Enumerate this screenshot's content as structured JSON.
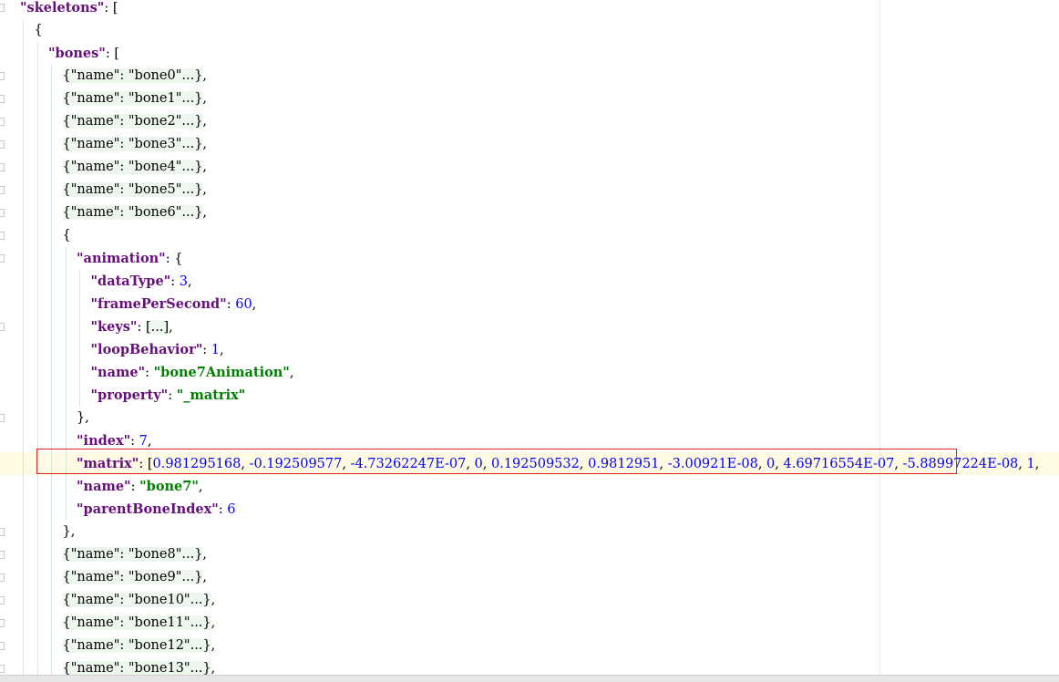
{
  "lines": [
    {
      "indent": 0,
      "parts": [
        {
          "t": "\"skeletons\"",
          "c": "k"
        },
        {
          "t": ": [",
          "c": "p"
        }
      ]
    },
    {
      "indent": 1,
      "parts": [
        {
          "t": "{",
          "c": "p"
        }
      ]
    },
    {
      "indent": 2,
      "parts": [
        {
          "t": "\"bones\"",
          "c": "k"
        },
        {
          "t": ": [",
          "c": "p"
        }
      ]
    },
    {
      "indent": 3,
      "parts": [
        {
          "t": "{\"name\": \"bone0\"...}",
          "c": "fold"
        },
        {
          "t": ",",
          "c": "p"
        }
      ]
    },
    {
      "indent": 3,
      "parts": [
        {
          "t": "{\"name\": \"bone1\"...}",
          "c": "fold"
        },
        {
          "t": ",",
          "c": "p"
        }
      ]
    },
    {
      "indent": 3,
      "parts": [
        {
          "t": "{\"name\": \"bone2\"...}",
          "c": "fold"
        },
        {
          "t": ",",
          "c": "p"
        }
      ]
    },
    {
      "indent": 3,
      "parts": [
        {
          "t": "{\"name\": \"bone3\"...}",
          "c": "fold"
        },
        {
          "t": ",",
          "c": "p"
        }
      ]
    },
    {
      "indent": 3,
      "parts": [
        {
          "t": "{\"name\": \"bone4\"...}",
          "c": "fold"
        },
        {
          "t": ",",
          "c": "p"
        }
      ]
    },
    {
      "indent": 3,
      "parts": [
        {
          "t": "{\"name\": \"bone5\"...}",
          "c": "fold"
        },
        {
          "t": ",",
          "c": "p"
        }
      ]
    },
    {
      "indent": 3,
      "parts": [
        {
          "t": "{\"name\": \"bone6\"...}",
          "c": "fold"
        },
        {
          "t": ",",
          "c": "p"
        }
      ]
    },
    {
      "indent": 3,
      "parts": [
        {
          "t": "{",
          "c": "p"
        }
      ]
    },
    {
      "indent": 4,
      "parts": [
        {
          "t": "\"animation\"",
          "c": "k"
        },
        {
          "t": ": {",
          "c": "p"
        }
      ]
    },
    {
      "indent": 5,
      "parts": [
        {
          "t": "\"dataType\"",
          "c": "k"
        },
        {
          "t": ": ",
          "c": "p"
        },
        {
          "t": "3",
          "c": "n"
        },
        {
          "t": ",",
          "c": "p"
        }
      ]
    },
    {
      "indent": 5,
      "parts": [
        {
          "t": "\"framePerSecond\"",
          "c": "k"
        },
        {
          "t": ": ",
          "c": "p"
        },
        {
          "t": "60",
          "c": "n"
        },
        {
          "t": ",",
          "c": "p"
        }
      ]
    },
    {
      "indent": 5,
      "parts": [
        {
          "t": "\"keys\"",
          "c": "k"
        },
        {
          "t": ": ",
          "c": "p"
        },
        {
          "t": "[...]",
          "c": "fold"
        },
        {
          "t": ",",
          "c": "p"
        }
      ]
    },
    {
      "indent": 5,
      "parts": [
        {
          "t": "\"loopBehavior\"",
          "c": "k"
        },
        {
          "t": ": ",
          "c": "p"
        },
        {
          "t": "1",
          "c": "n"
        },
        {
          "t": ",",
          "c": "p"
        }
      ]
    },
    {
      "indent": 5,
      "parts": [
        {
          "t": "\"name\"",
          "c": "k"
        },
        {
          "t": ": ",
          "c": "p"
        },
        {
          "t": "\"bone7Animation\"",
          "c": "s"
        },
        {
          "t": ",",
          "c": "p"
        }
      ]
    },
    {
      "indent": 5,
      "parts": [
        {
          "t": "\"property\"",
          "c": "k"
        },
        {
          "t": ": ",
          "c": "p"
        },
        {
          "t": "\"_matrix\"",
          "c": "s"
        }
      ]
    },
    {
      "indent": 4,
      "parts": [
        {
          "t": "},",
          "c": "p"
        }
      ]
    },
    {
      "indent": 4,
      "parts": [
        {
          "t": "\"index\"",
          "c": "k"
        },
        {
          "t": ": ",
          "c": "p"
        },
        {
          "t": "7",
          "c": "n"
        },
        {
          "t": ",",
          "c": "p"
        }
      ]
    },
    {
      "indent": 4,
      "parts": [
        {
          "t": "\"matrix\"",
          "c": "k"
        },
        {
          "t": ": [",
          "c": "p"
        },
        {
          "t": "0.981295168",
          "c": "n"
        },
        {
          "t": ", ",
          "c": "p"
        },
        {
          "t": "-0.192509577",
          "c": "n"
        },
        {
          "t": ", ",
          "c": "p"
        },
        {
          "t": "-4.73262247E-07",
          "c": "n"
        },
        {
          "t": ", ",
          "c": "p"
        },
        {
          "t": "0",
          "c": "n"
        },
        {
          "t": ", ",
          "c": "p"
        },
        {
          "t": "0.192509532",
          "c": "n"
        },
        {
          "t": ", ",
          "c": "p"
        },
        {
          "t": "0.9812951",
          "c": "n"
        },
        {
          "t": ", ",
          "c": "p"
        },
        {
          "t": "-3.00921E-08",
          "c": "n"
        },
        {
          "t": ", ",
          "c": "p"
        },
        {
          "t": "0",
          "c": "n"
        },
        {
          "t": ", ",
          "c": "p"
        },
        {
          "t": "4.69716554E-07",
          "c": "n"
        },
        {
          "t": ", ",
          "c": "p"
        },
        {
          "t": "-5.88997224E-08",
          "c": "n"
        },
        {
          "t": ", ",
          "c": "p"
        },
        {
          "t": "1",
          "c": "n"
        },
        {
          "t": ",",
          "c": "p"
        }
      ]
    },
    {
      "indent": 4,
      "parts": [
        {
          "t": "\"name\"",
          "c": "k"
        },
        {
          "t": ": ",
          "c": "p"
        },
        {
          "t": "\"bone7\"",
          "c": "s"
        },
        {
          "t": ",",
          "c": "p"
        }
      ]
    },
    {
      "indent": 4,
      "parts": [
        {
          "t": "\"parentBoneIndex\"",
          "c": "k"
        },
        {
          "t": ": ",
          "c": "p"
        },
        {
          "t": "6",
          "c": "n"
        }
      ]
    },
    {
      "indent": 3,
      "parts": [
        {
          "t": "},",
          "c": "p"
        }
      ]
    },
    {
      "indent": 3,
      "parts": [
        {
          "t": "{\"name\": \"bone8\"...}",
          "c": "fold"
        },
        {
          "t": ",",
          "c": "p"
        }
      ]
    },
    {
      "indent": 3,
      "parts": [
        {
          "t": "{\"name\": \"bone9\"...}",
          "c": "fold"
        },
        {
          "t": ",",
          "c": "p"
        }
      ]
    },
    {
      "indent": 3,
      "parts": [
        {
          "t": "{\"name\": \"bone10\"...}",
          "c": "fold"
        },
        {
          "t": ",",
          "c": "p"
        }
      ]
    },
    {
      "indent": 3,
      "parts": [
        {
          "t": "{\"name\": \"bone11\"...}",
          "c": "fold"
        },
        {
          "t": ",",
          "c": "p"
        }
      ]
    },
    {
      "indent": 3,
      "parts": [
        {
          "t": "{\"name\": \"bone12\"...}",
          "c": "fold"
        },
        {
          "t": ",",
          "c": "p"
        }
      ]
    },
    {
      "indent": 3,
      "parts": [
        {
          "t": "{\"name\": \"bone13\"...}",
          "c": "fold"
        },
        {
          "t": ",",
          "c": "p"
        }
      ]
    }
  ],
  "colors": {
    "key": "#660e7a",
    "string": "#008000",
    "number": "#0000ff",
    "fold_background": "#eef7ee",
    "current_line": "#fffae3",
    "highlight_border": "#e02424"
  }
}
